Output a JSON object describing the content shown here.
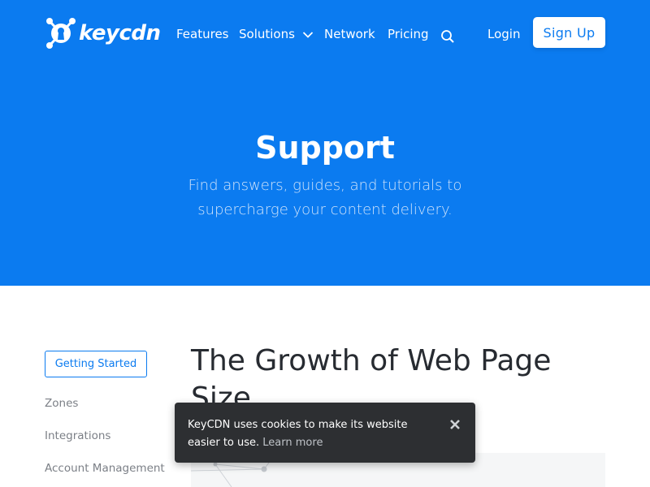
{
  "header": {
    "logo_text": "keycdn",
    "nav": {
      "features": "Features",
      "solutions": "Solutions",
      "network": "Network",
      "pricing": "Pricing",
      "login": "Login",
      "signup": "Sign Up"
    },
    "icons": {
      "search": "search-icon",
      "dropdown": "chevron-down-icon",
      "logo": "keycdn-logo-icon"
    }
  },
  "hero": {
    "title": "Support",
    "subtitle": "Find answers, guides, and tutorials to supercharge your content delivery."
  },
  "sidebar": {
    "active_item": "Getting Started",
    "items": [
      "Zones",
      "Integrations",
      "Account Management"
    ]
  },
  "article": {
    "title": "The Growth of Web Page Size"
  },
  "cookie_banner": {
    "text": "KeyCDN uses cookies to make its website easier to use.",
    "link": "Learn more",
    "close_icon": "close-icon"
  },
  "colors": {
    "brand_blue": "#0b7bf0",
    "banner_bg": "#2d2f32",
    "sidebar_text": "#7b7f86",
    "title_text": "#272b31"
  }
}
